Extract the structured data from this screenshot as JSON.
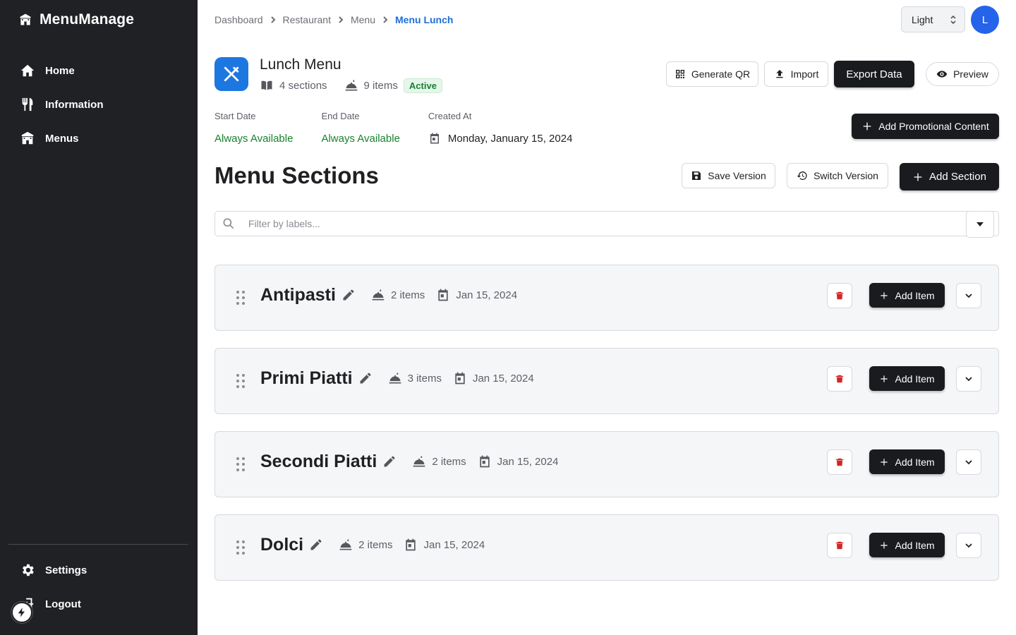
{
  "app": {
    "brand": "MenuManage"
  },
  "sidebar": {
    "items": [
      {
        "label": "Home",
        "icon": "home-icon"
      },
      {
        "label": "Information",
        "icon": "utensils-icon"
      },
      {
        "label": "Menus",
        "icon": "store-icon"
      }
    ],
    "bottom": [
      {
        "label": "Settings",
        "icon": "gear-icon"
      },
      {
        "label": "Logout",
        "icon": "logout-icon"
      }
    ]
  },
  "breadcrumb": [
    "Dashboard",
    "Restaurant",
    "Menu",
    "Menu Lunch"
  ],
  "header": {
    "theme": "Light",
    "avatar_initial": "L"
  },
  "menu": {
    "title": "Lunch Menu",
    "sections_count": "4 sections",
    "items_count": "9 items",
    "status": "Active",
    "start_label": "Start Date",
    "start_value": "Always Available",
    "end_label": "End Date",
    "end_value": "Always Available",
    "created_label": "Created At",
    "created_value": "Monday, January 15, 2024"
  },
  "actions": {
    "generate_qr": "Generate QR",
    "import": "Import",
    "export": "Export Data",
    "preview": "Preview",
    "add_promo": "Add Promotional Content",
    "save_version": "Save Version",
    "switch_version": "Switch Version",
    "add_section": "Add Section"
  },
  "sections_heading": "Menu Sections",
  "filter": {
    "placeholder": "Filter by labels..."
  },
  "add_item_label": "Add Item",
  "sections": [
    {
      "name": "Antipasti",
      "items": "2 items",
      "date": "Jan 15, 2024"
    },
    {
      "name": "Primi Piatti",
      "items": "3 items",
      "date": "Jan 15, 2024"
    },
    {
      "name": "Secondi Piatti",
      "items": "2 items",
      "date": "Jan 15, 2024"
    },
    {
      "name": "Dolci",
      "items": "2 items",
      "date": "Jan 15, 2024"
    }
  ],
  "colors": {
    "sidebar_bg": "#202124",
    "accent_blue": "#1d77e0",
    "link_blue": "#1d6fd6",
    "success_green": "#17812e",
    "danger_red": "#d32626",
    "dark_button": "#1a1b1f"
  }
}
